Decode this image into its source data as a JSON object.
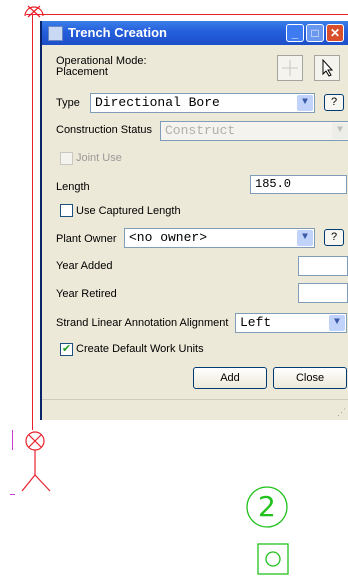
{
  "dialog": {
    "title": "Trench Creation",
    "mode_label": "Operational Mode:",
    "mode_value": "Placement",
    "type_label": "Type",
    "type_value": "Directional Bore",
    "construction_label": "Construction Status",
    "construction_value": "Construct",
    "joint_use_label": "Joint Use",
    "length_label": "Length",
    "length_value": "185.0",
    "use_captured_label": "Use Captured Length",
    "plant_owner_label": "Plant Owner",
    "plant_owner_value": "<no owner>",
    "year_added_label": "Year Added",
    "year_added_value": "",
    "year_retired_label": "Year Retired",
    "year_retired_value": "",
    "strand_label": "Strand Linear Annotation Alignment",
    "strand_value": "Left",
    "create_default_label": "Create Default Work Units",
    "add_label": "Add",
    "close_label": "Close",
    "help_label": "?"
  },
  "canvas": {
    "node_number": "2",
    "line_color": "#e8202a",
    "node_color": "#22c21d"
  },
  "icons": [
    "window-icon",
    "minimize-icon",
    "maximize-icon",
    "close-icon",
    "crosshair-icon",
    "arrow-cursor-icon",
    "chevron-down-icon",
    "check-icon",
    "circle-x-icon"
  ]
}
